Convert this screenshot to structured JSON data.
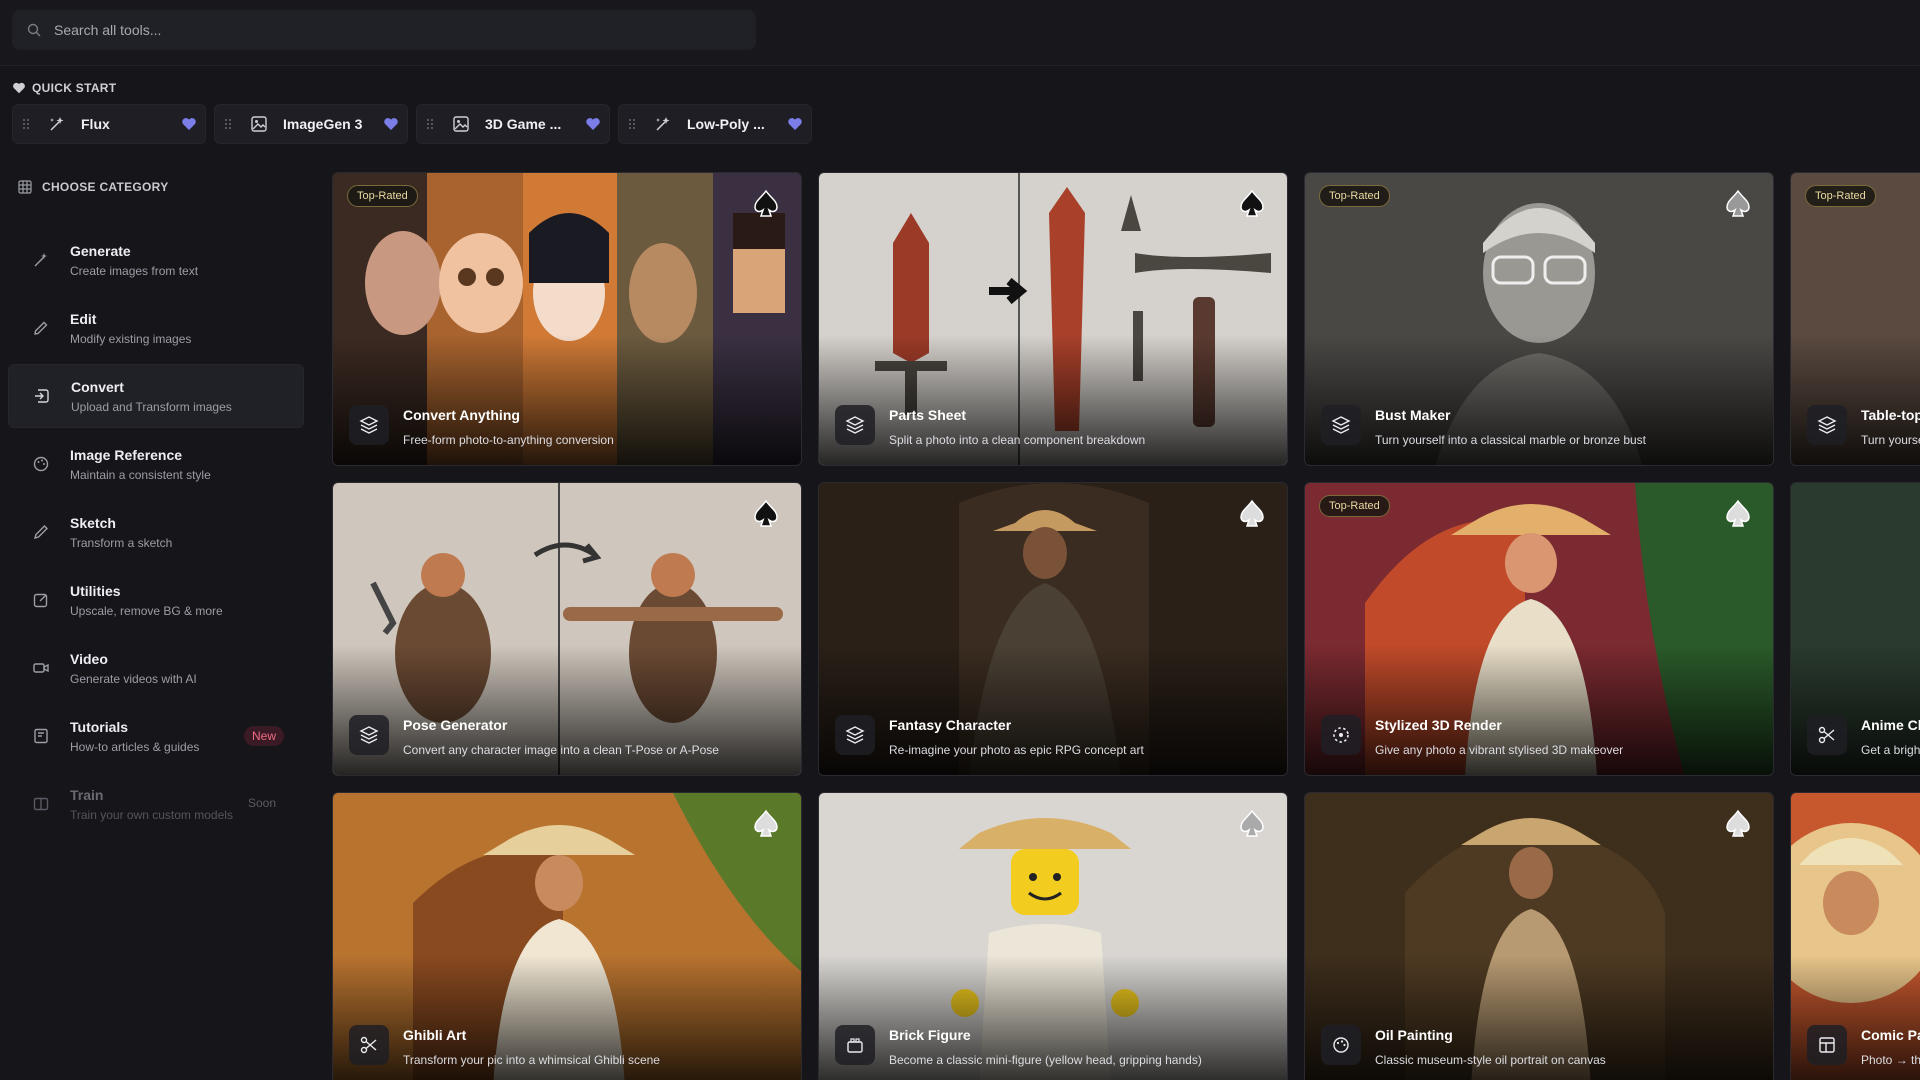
{
  "search": {
    "placeholder": "Search all tools..."
  },
  "quick_start": {
    "title": "QUICK START",
    "items": [
      {
        "label": "Flux",
        "icon": "sparkle-wand-icon"
      },
      {
        "label": "ImageGen 3",
        "icon": "image-icon"
      },
      {
        "label": "3D Game ...",
        "icon": "image-icon"
      },
      {
        "label": "Low-Poly ...",
        "icon": "sparkle-wand-icon"
      }
    ]
  },
  "sidebar": {
    "title": "CHOOSE CATEGORY",
    "items": [
      {
        "label": "Generate",
        "desc": "Create images from text",
        "icon": "magic-wand-icon"
      },
      {
        "label": "Edit",
        "desc": "Modify existing images",
        "icon": "pencil-icon"
      },
      {
        "label": "Convert",
        "desc": "Upload and Transform images",
        "icon": "convert-icon"
      },
      {
        "label": "Image Reference",
        "desc": "Maintain a consistent style",
        "icon": "palette-icon"
      },
      {
        "label": "Sketch",
        "desc": "Transform a sketch",
        "icon": "pen-icon"
      },
      {
        "label": "Utilities",
        "desc": "Upscale, remove BG & more",
        "icon": "edit-box-icon"
      },
      {
        "label": "Video",
        "desc": "Generate videos with AI",
        "icon": "video-icon"
      },
      {
        "label": "Tutorials",
        "desc": "How-to articles & guides",
        "icon": "book-icon",
        "badge": "New"
      },
      {
        "label": "Train",
        "desc": "Train your own custom models",
        "icon": "train-icon",
        "badge": "Soon"
      }
    ]
  },
  "cards": {
    "top_rated_label": "Top-Rated",
    "items": [
      {
        "title": "Convert Anything",
        "desc": "Free-form photo-to-anything conversion"
      },
      {
        "title": "Parts Sheet",
        "desc": "Split a photo into a clean component breakdown"
      },
      {
        "title": "Bust Maker",
        "desc": "Turn yourself into a classical marble or bronze bust"
      },
      {
        "title": "Table-top",
        "desc": "Turn yourse"
      },
      {
        "title": "Pose Generator",
        "desc": "Convert any character image into a clean T-Pose or A-Pose"
      },
      {
        "title": "Fantasy Character",
        "desc": "Re-imagine your photo as epic RPG concept art"
      },
      {
        "title": "Stylized 3D Render",
        "desc": "Give any photo a vibrant stylised 3D makeover"
      },
      {
        "title": "Anime Ch",
        "desc": "Get a brigh"
      },
      {
        "title": "Ghibli Art",
        "desc": "Transform your pic into a whimsical Ghibli scene"
      },
      {
        "title": "Brick Figure",
        "desc": "Become a classic mini-figure (yellow head, gripping hands)"
      },
      {
        "title": "Oil Painting",
        "desc": "Classic museum-style oil portrait on canvas"
      },
      {
        "title": "Comic Pa",
        "desc": "Photo → th"
      }
    ]
  }
}
